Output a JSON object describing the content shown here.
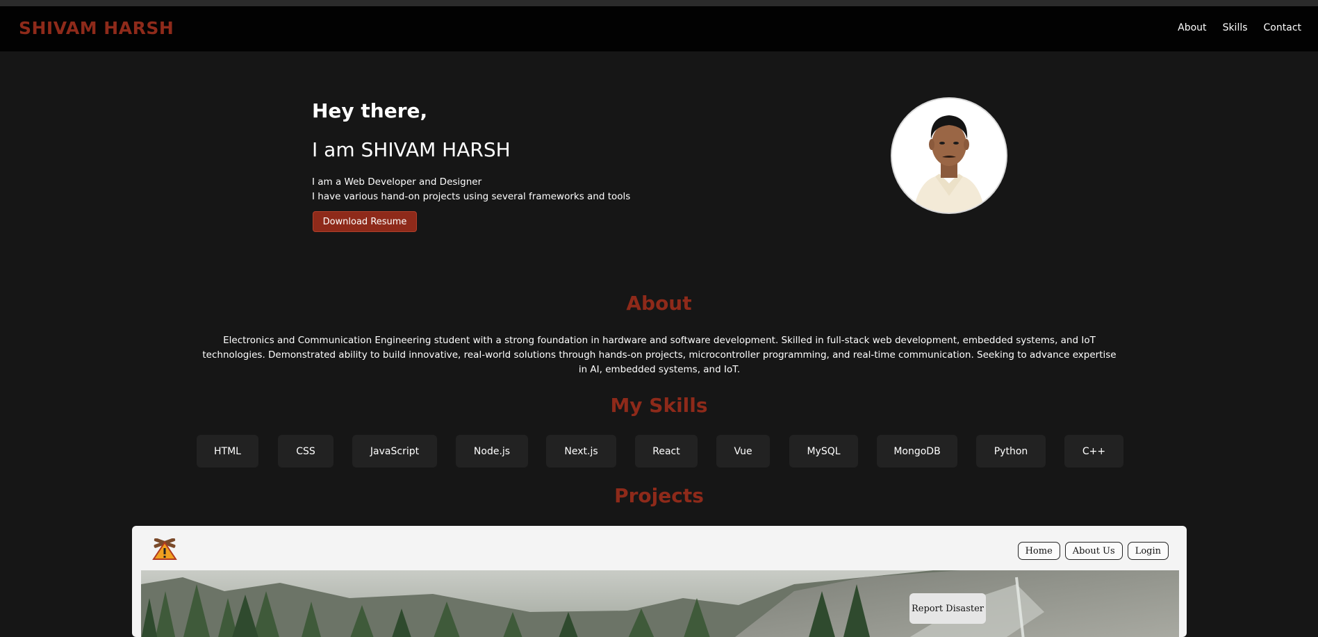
{
  "nav": {
    "brand": "SHIVAM HARSH",
    "links": [
      "About",
      "Skills",
      "Contact"
    ]
  },
  "hero": {
    "greeting": "Hey there,",
    "name": "I am SHIVAM HARSH",
    "line1": "I am a Web Developer and Designer",
    "line2": "I have various hand-on projects using several frameworks and tools",
    "button": "Download Resume"
  },
  "about": {
    "title": "About",
    "text": "Electronics and Communication Engineering student with a strong foundation in hardware and software development. Skilled in full-stack web development, embedded systems, and IoT technologies. Demonstrated ability to build innovative, real-world solutions through hands-on projects, microcontroller programming, and real-time communication. Seeking to advance expertise in AI, embedded systems, and IoT."
  },
  "skills": {
    "title": "My Skills",
    "items": [
      "HTML",
      "CSS",
      "JavaScript",
      "Node.js",
      "Next.js",
      "React",
      "Vue",
      "MySQL",
      "MongoDB",
      "Python",
      "C++"
    ]
  },
  "projects": {
    "title": "Projects",
    "card": {
      "logo_icon": "disaster-warning-icon",
      "nav": [
        "Home",
        "About Us",
        "Login"
      ],
      "report_button": "Report Disaster"
    }
  },
  "colors": {
    "accent": "#8e2a1a",
    "background": "#161616",
    "navbar": "#020202",
    "chip": "#222222"
  }
}
